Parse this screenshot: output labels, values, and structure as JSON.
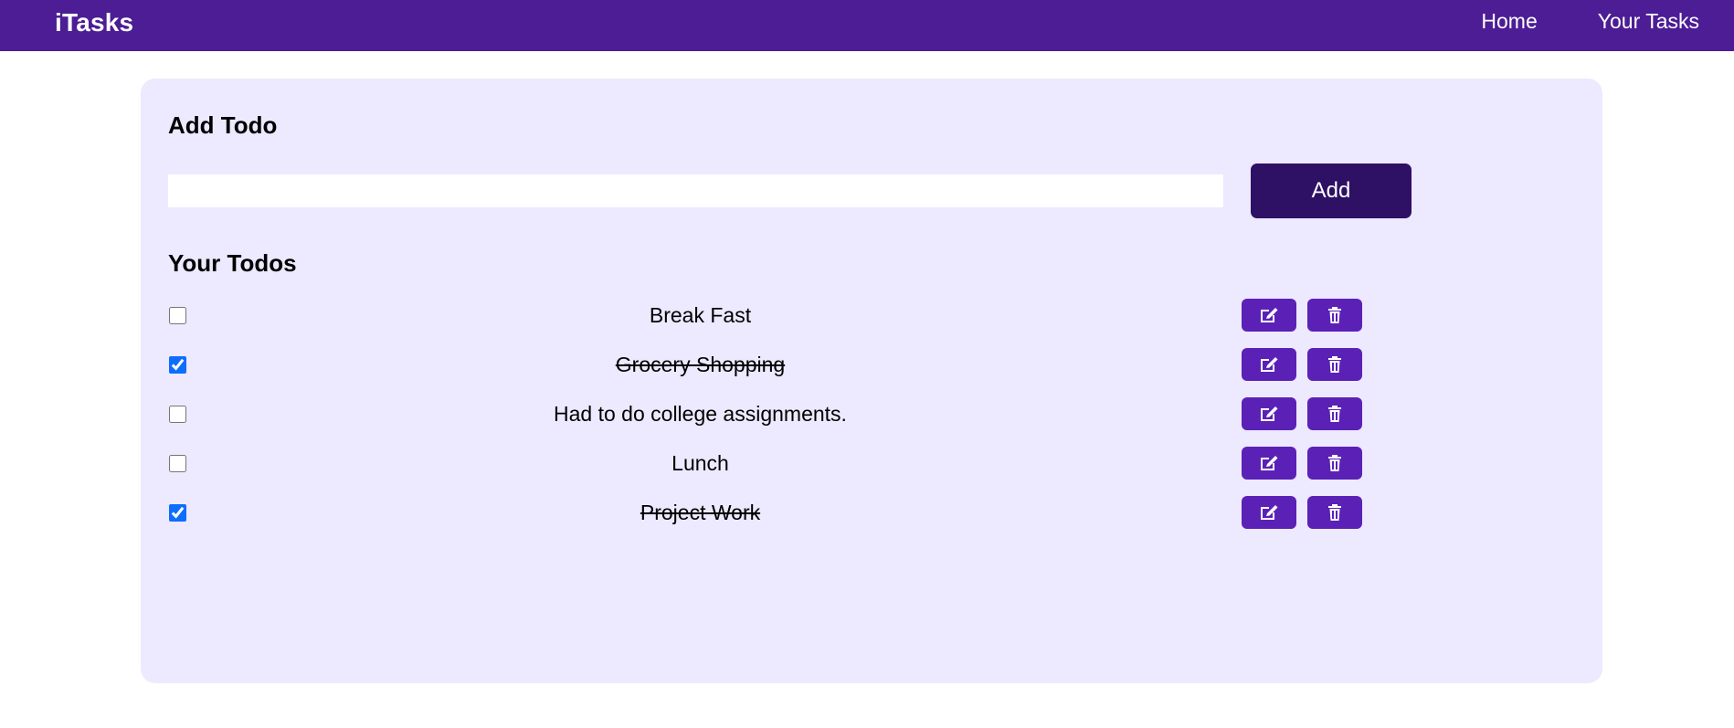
{
  "navbar": {
    "brand": "iTasks",
    "links": [
      "Home",
      "Your Tasks"
    ]
  },
  "add_section": {
    "heading": "Add Todo",
    "input_value": "",
    "button_label": "Add"
  },
  "todos_section": {
    "heading": "Your Todos",
    "items": [
      {
        "text": "Break Fast",
        "completed": false
      },
      {
        "text": "Grocery Shopping",
        "completed": true
      },
      {
        "text": "Had to do college assignments.",
        "completed": false
      },
      {
        "text": "Lunch",
        "completed": false
      },
      {
        "text": "Project Work",
        "completed": true
      }
    ]
  },
  "icons": {
    "edit": "edit-icon",
    "delete": "trash-icon"
  },
  "colors": {
    "navbar": "#4c1d95",
    "panel": "#ede9fe",
    "add_button": "#2e1065",
    "action_button": "#5b21b6"
  }
}
